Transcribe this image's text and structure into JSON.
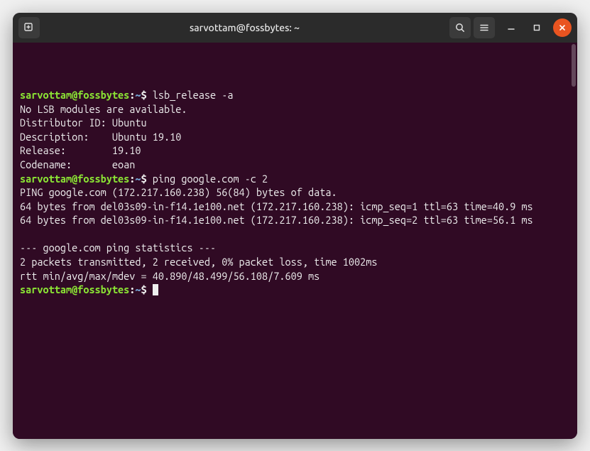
{
  "window": {
    "title": "sarvottam@fossbytes: ~"
  },
  "prompt": {
    "user_host": "sarvottam@fossbytes",
    "sep": ":",
    "path": "~",
    "dollar": "$"
  },
  "lines": [
    {
      "type": "cmd",
      "text": "lsb_release -a"
    },
    {
      "type": "out",
      "text": "No LSB modules are available."
    },
    {
      "type": "out",
      "text": "Distributor ID: Ubuntu"
    },
    {
      "type": "out",
      "text": "Description:    Ubuntu 19.10"
    },
    {
      "type": "out",
      "text": "Release:        19.10"
    },
    {
      "type": "out",
      "text": "Codename:       eoan"
    },
    {
      "type": "cmd",
      "text": "ping google.com -c 2"
    },
    {
      "type": "out",
      "text": "PING google.com (172.217.160.238) 56(84) bytes of data."
    },
    {
      "type": "out",
      "text": "64 bytes from del03s09-in-f14.1e100.net (172.217.160.238): icmp_seq=1 ttl=63 time=40.9 ms"
    },
    {
      "type": "out",
      "text": "64 bytes from del03s09-in-f14.1e100.net (172.217.160.238): icmp_seq=2 ttl=63 time=56.1 ms"
    },
    {
      "type": "out",
      "text": ""
    },
    {
      "type": "out",
      "text": "--- google.com ping statistics ---"
    },
    {
      "type": "out",
      "text": "2 packets transmitted, 2 received, 0% packet loss, time 1002ms"
    },
    {
      "type": "out",
      "text": "rtt min/avg/max/mdev = 40.890/48.499/56.108/7.609 ms"
    },
    {
      "type": "prompt",
      "text": ""
    }
  ]
}
